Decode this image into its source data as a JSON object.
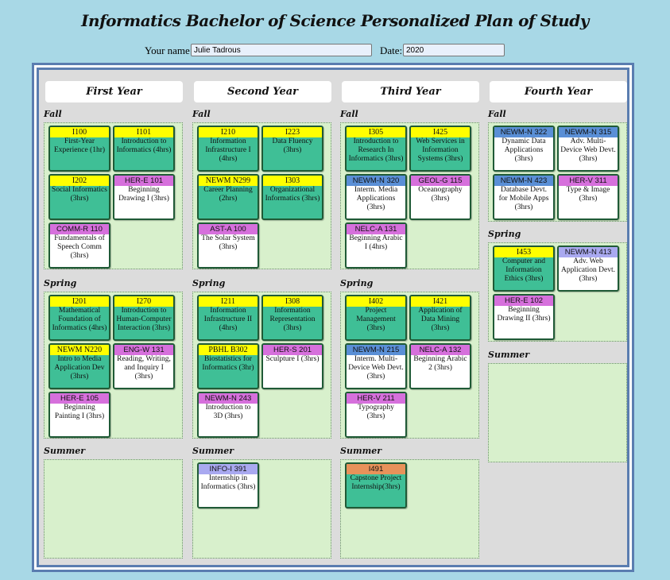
{
  "page_title": "Informatics Bachelor of Science Personalized Plan of Study",
  "form": {
    "name_label": "Your name:",
    "name_value": "Julie Tadrous",
    "date_label": "Date:",
    "date_value": "2020"
  },
  "years": [
    {
      "title": "First Year",
      "terms": [
        {
          "label": "Fall",
          "courses": [
            {
              "code": "I100",
              "title": "First-Year Experience (1hr)",
              "hdr": "yellow",
              "body": "green"
            },
            {
              "code": "I101",
              "title": "Introduction to Informatics (4hrs)",
              "hdr": "yellow",
              "body": "green"
            },
            {
              "code": "I202",
              "title": "Social Informatics (3hrs)",
              "hdr": "yellow",
              "body": "green"
            },
            {
              "code": "HER-E 101",
              "title": "Beginning Drawing I (3hrs)",
              "hdr": "magenta",
              "body": "white"
            },
            {
              "code": "COMM-R 110",
              "title": "Fundamentals of Speech Comm (3hrs)",
              "hdr": "magenta",
              "body": "white"
            }
          ]
        },
        {
          "label": "Spring",
          "courses": [
            {
              "code": "I201",
              "title": "Mathematical Foundation of Informatics (4hrs)",
              "hdr": "yellow",
              "body": "green"
            },
            {
              "code": "I270",
              "title": "Introduction to Human-Computer Interaction (3hrs)",
              "hdr": "yellow",
              "body": "green"
            },
            {
              "code": "NEWM N220",
              "title": "Intro to Media Application Dev (3hrs)",
              "hdr": "yellow",
              "body": "green"
            },
            {
              "code": "ENG-W 131",
              "title": "Reading, Writing, and Inquiry I (3hrs)",
              "hdr": "magenta",
              "body": "white"
            },
            {
              "code": "HER-E 105",
              "title": "Beginning Painting I (3hrs)",
              "hdr": "magenta",
              "body": "white"
            }
          ]
        },
        {
          "label": "Summer",
          "courses": []
        }
      ]
    },
    {
      "title": "Second Year",
      "terms": [
        {
          "label": "Fall",
          "courses": [
            {
              "code": "I210",
              "title": "Information Infrastructure I (4hrs)",
              "hdr": "yellow",
              "body": "green"
            },
            {
              "code": "I223",
              "title": "Data Fluency (3hrs)",
              "hdr": "yellow",
              "body": "green"
            },
            {
              "code": "NEWM N299",
              "title": "Career Planning (2hrs)",
              "hdr": "yellow",
              "body": "green"
            },
            {
              "code": "I303",
              "title": "Organizational Informatics (3hrs)",
              "hdr": "yellow",
              "body": "green"
            },
            {
              "code": "AST-A 100",
              "title": "The Solar System (3hrs)",
              "hdr": "magenta",
              "body": "white"
            }
          ]
        },
        {
          "label": "Spring",
          "courses": [
            {
              "code": "I211",
              "title": "Information Infrastructure II (4hrs)",
              "hdr": "yellow",
              "body": "green"
            },
            {
              "code": "I308",
              "title": "Information Representation (3hrs)",
              "hdr": "yellow",
              "body": "green"
            },
            {
              "code": "PBHL B302",
              "title": "Biostatistics for Informatics (3hr)",
              "hdr": "yellow",
              "body": "green"
            },
            {
              "code": "HER-S 201",
              "title": "Sculpture I (3hrs)",
              "hdr": "magenta",
              "body": "white"
            },
            {
              "code": "NEWM-N 243",
              "title": "Introduction to 3D (3hrs)",
              "hdr": "magenta",
              "body": "white"
            }
          ]
        },
        {
          "label": "Summer",
          "courses": [
            {
              "code": "INFO-I 391",
              "title": "Internship in Informatics (3hrs)",
              "hdr": "lav",
              "body": "white"
            }
          ]
        }
      ]
    },
    {
      "title": "Third Year",
      "terms": [
        {
          "label": "Fall",
          "courses": [
            {
              "code": "I305",
              "title": "Introduction to Research In Informatics (3hrs)",
              "hdr": "yellow",
              "body": "green"
            },
            {
              "code": "I425",
              "title": "Web Services in Information Systems (3hrs)",
              "hdr": "yellow",
              "body": "green"
            },
            {
              "code": "NEWM-N 320",
              "title": "Interm. Media Applications (3hrs)",
              "hdr": "blue",
              "body": "white"
            },
            {
              "code": "GEOL-G 115",
              "title": "Oceanography (3hrs)",
              "hdr": "magenta",
              "body": "white"
            },
            {
              "code": "NELC-A 131",
              "title": "Beginning Arabic I (4hrs)",
              "hdr": "magenta",
              "body": "white"
            }
          ]
        },
        {
          "label": "Spring",
          "courses": [
            {
              "code": "I402",
              "title": "Project Management (3hrs)",
              "hdr": "yellow",
              "body": "green"
            },
            {
              "code": "I421",
              "title": "Application of Data Mining (3hrs)",
              "hdr": "yellow",
              "body": "green"
            },
            {
              "code": "NEWM-N 215",
              "title": "Interm. Multi-Device Web Devt. (3hrs)",
              "hdr": "blue",
              "body": "white"
            },
            {
              "code": "NELC-A 132",
              "title": "Beginning Arabic 2 (3hrs)",
              "hdr": "magenta",
              "body": "white"
            },
            {
              "code": "HER-V 211",
              "title": "Typography (3hrs)",
              "hdr": "magenta",
              "body": "white"
            }
          ]
        },
        {
          "label": "Summer",
          "courses": [
            {
              "code": "I491",
              "title": "Capstone Project Internship(3hrs)",
              "hdr": "orange",
              "body": "green"
            }
          ]
        }
      ]
    },
    {
      "title": "Fourth Year",
      "terms": [
        {
          "label": "Fall",
          "courses": [
            {
              "code": "NEWM-N 322",
              "title": "Dynamic Data Applications (3hrs)",
              "hdr": "blue",
              "body": "white"
            },
            {
              "code": "NEWM-N 315",
              "title": "Adv. Multi-Device Web Devt. (3hrs)",
              "hdr": "blue",
              "body": "white"
            },
            {
              "code": "NEWM-N 423",
              "title": "Database Devt. for Mobile Apps (3hrs)",
              "hdr": "blue",
              "body": "white"
            },
            {
              "code": "HER-V 311",
              "title": "Type & Image (3hrs)",
              "hdr": "magenta",
              "body": "white"
            }
          ]
        },
        {
          "label": "Spring",
          "courses": [
            {
              "code": "I453",
              "title": "Computer and Information Ethics (3hrs)",
              "hdr": "yellow",
              "body": "green"
            },
            {
              "code": "NEWM-N 413",
              "title": "Adv. Web Application Devt. (3hrs)",
              "hdr": "lav",
              "body": "white"
            },
            {
              "code": "HER-E 102",
              "title": "Beginning Drawing II (3hrs)",
              "hdr": "magenta",
              "body": "white"
            }
          ]
        },
        {
          "label": "Summer",
          "courses": []
        }
      ]
    }
  ]
}
